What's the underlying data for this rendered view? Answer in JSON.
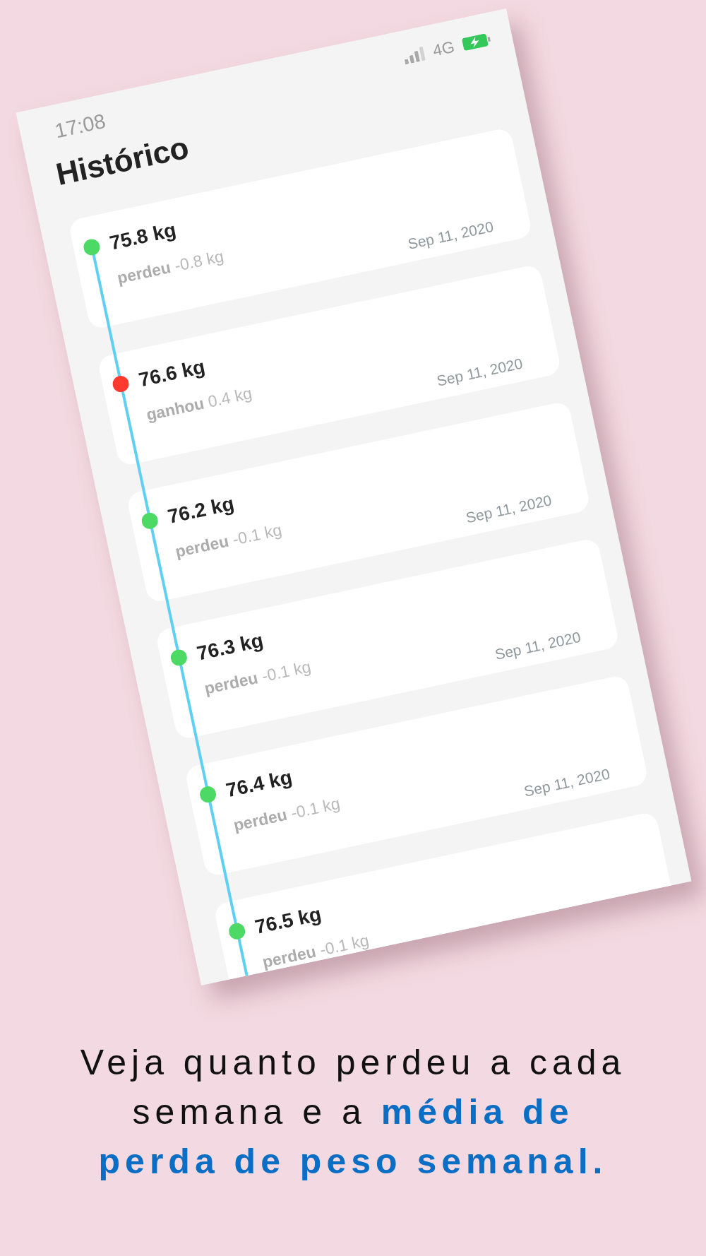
{
  "status_bar": {
    "time": "17:08",
    "network": "4G"
  },
  "screen": {
    "title": "Histórico"
  },
  "entries": [
    {
      "weight": "75.8 kg",
      "change": "**perdeu** -0.8 kg",
      "date": "Sep 11, 2020",
      "color": "#4cd964"
    },
    {
      "weight": "76.6 kg",
      "change": "**ganhou** 0.4 kg",
      "date": "Sep 11, 2020",
      "color": "#ff3b30"
    },
    {
      "weight": "76.2 kg",
      "change": "**perdeu** -0.1 kg",
      "date": "Sep 11, 2020",
      "color": "#4cd964"
    },
    {
      "weight": "76.3 kg",
      "change": "**perdeu** -0.1 kg",
      "date": "Sep 11, 2020",
      "color": "#4cd964"
    },
    {
      "weight": "76.4 kg",
      "change": "**perdeu** -0.1 kg",
      "date": "Sep 11, 2020",
      "color": "#4cd964"
    },
    {
      "weight": "76.5 kg",
      "change": "**perdeu** -0.1 kg",
      "color": "#4cd964"
    }
  ],
  "caption": "Veja quanto perdeu a cada semana e a **média de perda de peso semanal.**"
}
